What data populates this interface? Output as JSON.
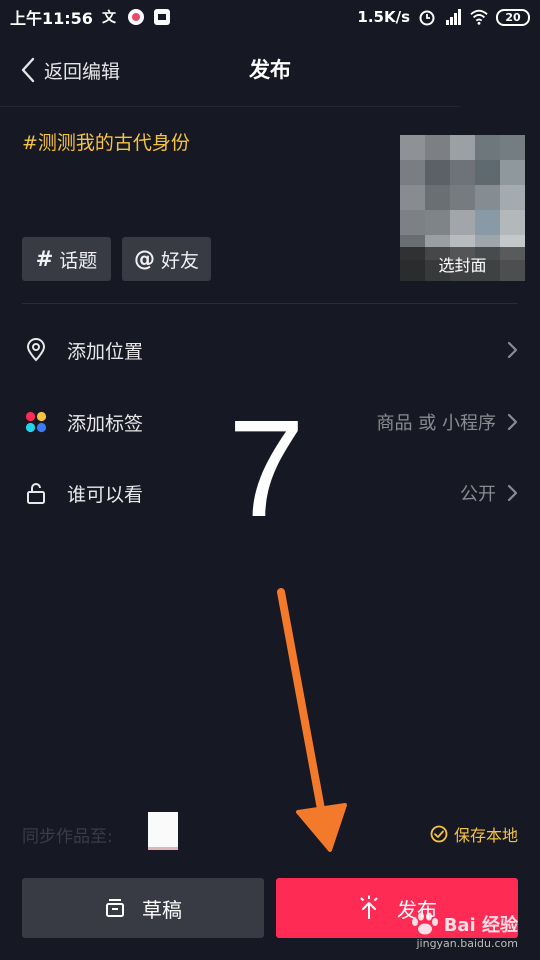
{
  "status_bar": {
    "time": "上午11:56",
    "speed": "1.5K/s",
    "battery": "20"
  },
  "nav": {
    "back_label": "返回编辑",
    "title": "发布"
  },
  "post": {
    "caption": "#测测我的古代身份",
    "cover_label": "选封面",
    "chips": {
      "topic_symbol": "#",
      "topic_label": "话题",
      "friend_symbol": "@",
      "friend_label": "好友"
    }
  },
  "settings": [
    {
      "label": "添加位置",
      "value": "",
      "icon": "location-pin-icon"
    },
    {
      "label": "添加标签",
      "value": "商品 或 小程序",
      "icon": "colored-dots-icon"
    },
    {
      "label": "谁可以看",
      "value": "公开",
      "icon": "unlock-icon"
    }
  ],
  "overlay": {
    "step_number": "7"
  },
  "footer": {
    "sync_label": "同步作品至:",
    "save_local_label": "保存本地",
    "draft_label": "草稿",
    "publish_label": "发布"
  },
  "watermark": {
    "main": "Bai 经验",
    "sub": "jingyan.baidu.com"
  },
  "colors": {
    "background": "#161823",
    "accent_red": "#fe2c55",
    "accent_yellow": "#f5c243",
    "chip_bg": "#393b44",
    "annotation_arrow": "#f27a2a"
  }
}
